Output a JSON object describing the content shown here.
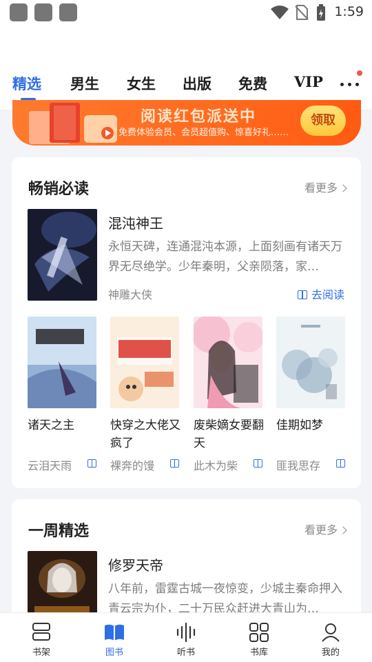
{
  "status_bar": {
    "time": "1:59"
  },
  "tabs": [
    "精选",
    "男生",
    "女生",
    "出版",
    "免费",
    "VIP"
  ],
  "banner": {
    "title": "阅读红包派送中",
    "subtitle": "免费体验会员、会员超值购、惊喜好礼……",
    "button": "领取"
  },
  "bestsellers": {
    "title": "畅销必读",
    "see_more": "看更多",
    "featured": {
      "name": "混沌神王",
      "desc": "永恒天碑，连通混沌本源，上面刻画有诸天万界无尽绝学。少年秦明，父亲陨落，家…",
      "author": "神雕大侠",
      "read": "去阅读"
    },
    "books": [
      {
        "name": "诸天之主",
        "author": "云泪天雨"
      },
      {
        "name": "快穿之大佬又疯了",
        "author": "裸奔的馒"
      },
      {
        "name": "废柴嫡女要翻天",
        "author": "此木为柴"
      },
      {
        "name": "佳期如梦",
        "author": "匪我思存"
      }
    ]
  },
  "weekly": {
    "title": "一周精选",
    "see_more": "看更多",
    "featured": {
      "name": "修罗天帝",
      "desc": "八年前，雷霆古城一夜惊变，少城主秦命押入青云宗为仆，二十万民众赶进大青山为…"
    }
  },
  "bottom_nav": [
    {
      "label": "书架",
      "icon": "bookshelf-icon"
    },
    {
      "label": "图书",
      "icon": "book-open-icon"
    },
    {
      "label": "听书",
      "icon": "audio-wave-icon"
    },
    {
      "label": "书库",
      "icon": "grid-icon"
    },
    {
      "label": "我的",
      "icon": "user-icon"
    }
  ],
  "colors": {
    "accent": "#2f6fe4",
    "banner": "#ff6a1e",
    "badge": "#f2564f"
  }
}
